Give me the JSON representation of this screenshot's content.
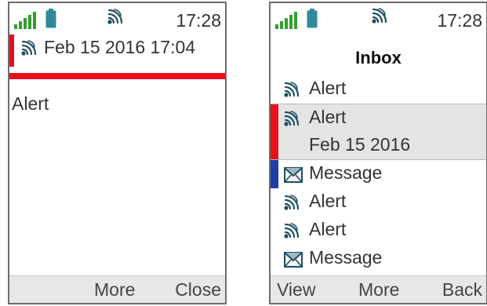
{
  "colors": {
    "signal_green": "#33a02c",
    "battery_teal": "#2e8a9a",
    "alert_red": "#e8101b",
    "message_blue": "#1c3fa8",
    "icon_dark": "#1f4f62"
  },
  "left_screen": {
    "status": {
      "time": "17:28",
      "icons": [
        "signal-icon",
        "battery-icon",
        "alert-wave-icon"
      ]
    },
    "message": {
      "icon": "alert-wave-icon",
      "date": "Feb 15 2016 17:04",
      "body": "Alert"
    },
    "softkeys": {
      "more": "More",
      "close": "Close"
    }
  },
  "right_screen": {
    "status": {
      "time": "17:28",
      "icons": [
        "signal-icon",
        "battery-icon",
        "alert-wave-icon"
      ]
    },
    "title": "Inbox",
    "items": [
      {
        "type": "alert",
        "label": "Alert"
      },
      {
        "type": "alert",
        "label": "Alert",
        "date": "Feb 15 2016",
        "selected": true,
        "marker": "red"
      },
      {
        "type": "message",
        "label": "Message",
        "marker": "blue"
      },
      {
        "type": "alert",
        "label": "Alert"
      },
      {
        "type": "alert",
        "label": "Alert"
      },
      {
        "type": "message",
        "label": "Message"
      }
    ],
    "softkeys": {
      "view": "View",
      "more": "More",
      "back": "Back"
    }
  }
}
